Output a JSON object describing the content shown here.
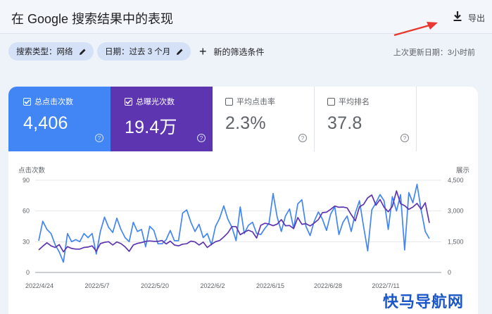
{
  "header": {
    "title": "在 Google 搜索结果中的表现",
    "export_label": "导出"
  },
  "filters": {
    "search_type": "搜索类型：网络",
    "date": "日期：过去 3 个月",
    "new_filter": "新的筛选条件",
    "last_update": "上次更新日期：3小时前"
  },
  "metrics": [
    {
      "label": "总点击次数",
      "value": "4,406",
      "checked": true,
      "color": "#4285f4"
    },
    {
      "label": "总曝光次数",
      "value": "19.4万",
      "checked": true,
      "color": "#5e35b1"
    },
    {
      "label": "平均点击率",
      "value": "2.3%",
      "checked": false
    },
    {
      "label": "平均排名",
      "value": "37.8",
      "checked": false
    }
  ],
  "watermark": "快马导航网",
  "chart_data": {
    "type": "line",
    "ylabel_left": "点击次数",
    "ylabel_right": "展示",
    "y_left_ticks": [
      "0",
      "30",
      "60",
      "90"
    ],
    "y_right_ticks": [
      "0",
      "1,500",
      "3,000",
      "4,500"
    ],
    "ylim_left": [
      0,
      90
    ],
    "ylim_right": [
      0,
      4500
    ],
    "x_tick_labels": [
      "2022/4/24",
      "2022/5/7",
      "2022/5/20",
      "2022/6/2",
      "2022/6/15",
      "2022/6/28",
      "2022/7/11"
    ],
    "grid": true,
    "series": [
      {
        "name": "总点击次数",
        "axis": "left",
        "color": "#4285f4",
        "values": [
          31,
          50,
          42,
          38,
          27,
          20,
          10,
          38,
          30,
          32,
          30,
          38,
          34,
          38,
          18,
          40,
          54,
          44,
          39,
          53,
          42,
          34,
          30,
          49,
          40,
          42,
          25,
          45,
          41,
          28,
          28,
          32,
          41,
          31,
          31,
          58,
          61,
          49,
          40,
          47,
          34,
          38,
          27,
          45,
          53,
          65,
          52,
          44,
          31,
          64,
          38,
          46,
          49,
          38,
          37,
          43,
          48,
          77,
          54,
          40,
          55,
          62,
          43,
          67,
          71,
          45,
          36,
          50,
          59,
          52,
          41,
          57,
          64,
          37,
          49,
          55,
          40,
          58,
          70,
          45,
          21,
          61,
          68,
          76,
          70,
          42,
          74,
          60,
          76,
          22,
          78,
          68,
          86,
          61,
          40,
          33
        ]
      },
      {
        "name": "总曝光次数",
        "axis": "right",
        "color": "#5e35b1",
        "values": [
          1100,
          1280,
          1450,
          1300,
          1220,
          1360,
          1010,
          1260,
          1170,
          1140,
          1140,
          1220,
          1240,
          1300,
          1040,
          1410,
          1470,
          1500,
          1340,
          1490,
          1410,
          1250,
          1030,
          1340,
          1420,
          1460,
          1520,
          1540,
          1520,
          1520,
          1560,
          1390,
          1530,
          1340,
          1300,
          1380,
          1400,
          1530,
          1490,
          1340,
          1480,
          1220,
          1370,
          1500,
          1560,
          1730,
          1930,
          2240,
          2240,
          1840,
          1960,
          2060,
          1980,
          1680,
          2300,
          2400,
          2360,
          2280,
          2360,
          2580,
          2280,
          2290,
          2140,
          2680,
          2350,
          2380,
          2270,
          2410,
          2580,
          2920,
          2940,
          3080,
          3240,
          3180,
          3190,
          3150,
          2820,
          2520,
          3200,
          3320,
          3640,
          3780,
          3280,
          3560,
          3180,
          2960,
          3220,
          3980,
          3360,
          3260,
          3080,
          3190,
          3370,
          3080,
          3400,
          2420
        ]
      }
    ]
  }
}
